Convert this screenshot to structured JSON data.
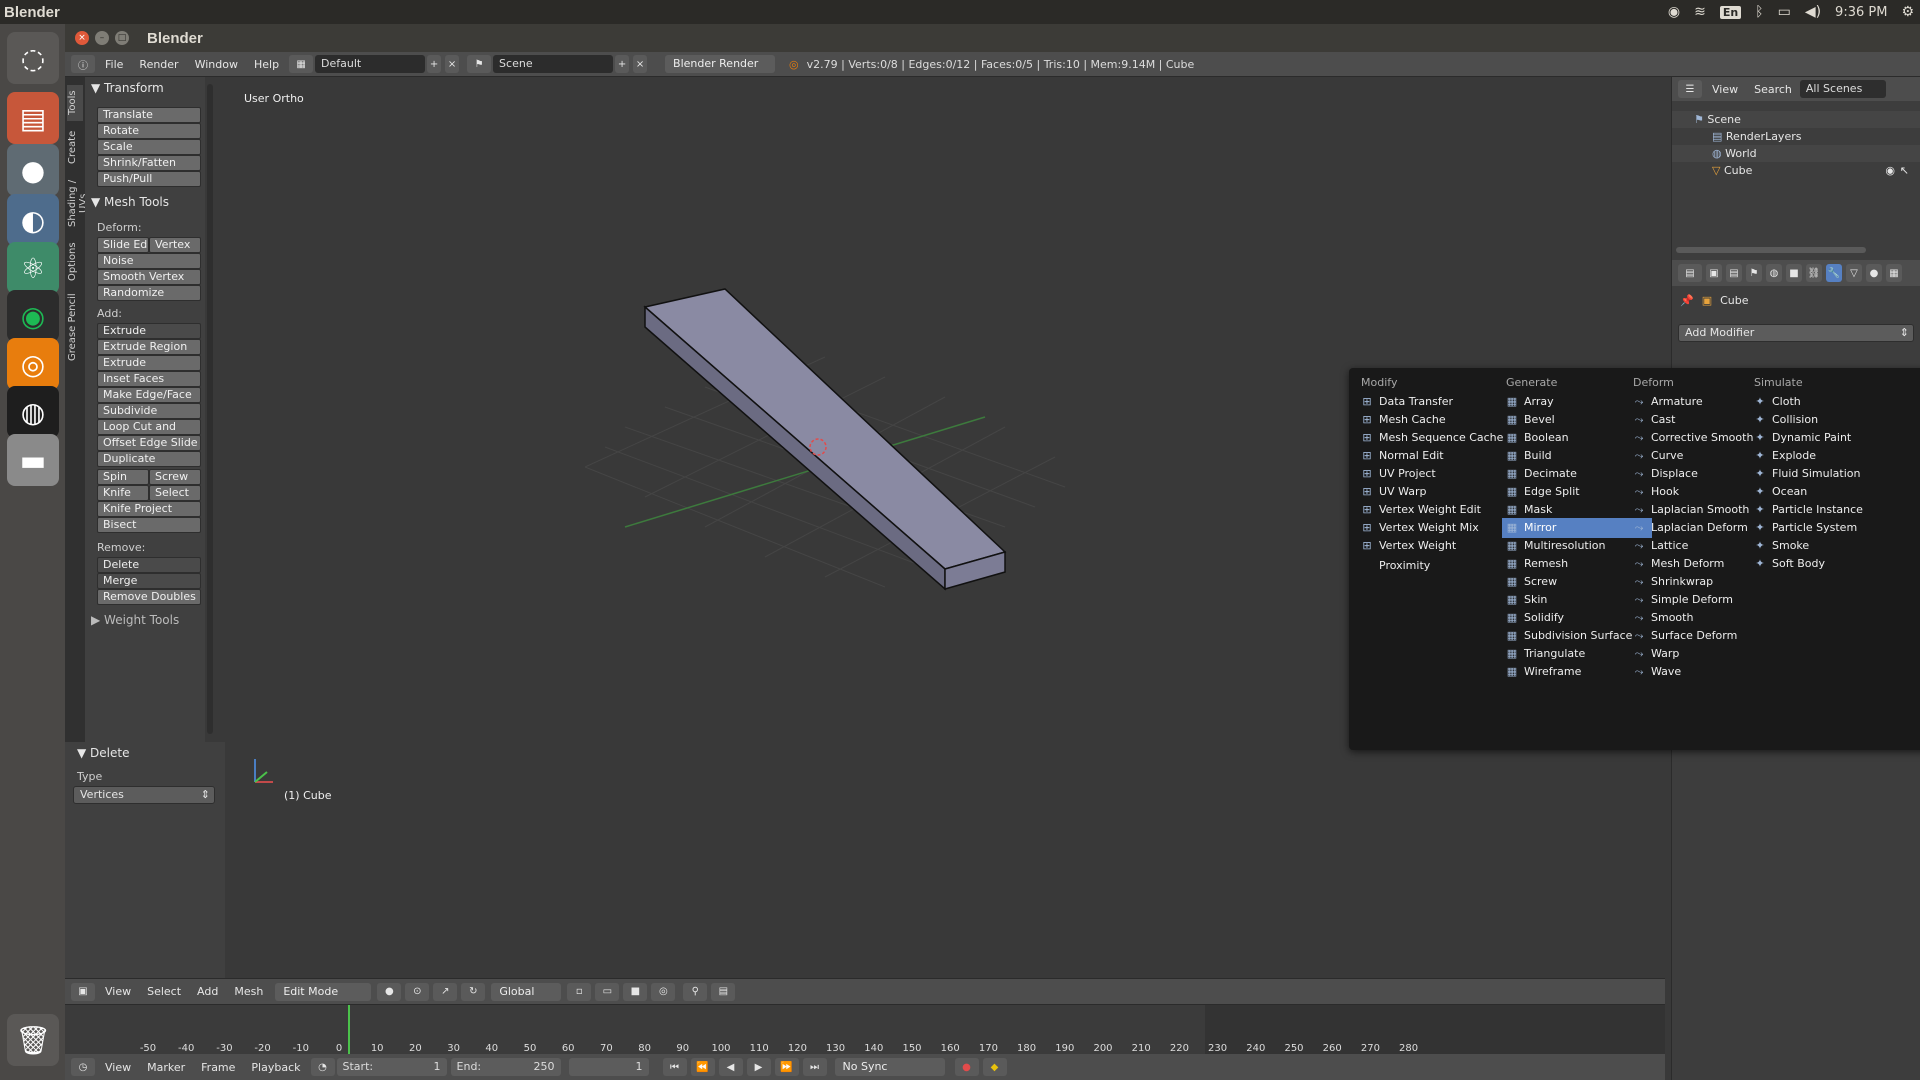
{
  "os": {
    "app_title": "Blender",
    "keyboard_layout": "En",
    "clock": "9:36 PM"
  },
  "window": {
    "title": "Blender"
  },
  "infobar": {
    "menus": [
      "File",
      "Render",
      "Window",
      "Help"
    ],
    "screen_layout": "Default",
    "scene": "Scene",
    "render_engine": "Blender Render",
    "stats": "v2.79 | Verts:0/8 | Edges:0/12 | Faces:0/5 | Tris:10 | Mem:9.14M | Cube"
  },
  "toolshelf": {
    "tabs": [
      "Tools",
      "Create",
      "Shading / UVs",
      "Options",
      "Grease Pencil"
    ],
    "transform_header": "Transform",
    "transform_buttons": [
      "Translate",
      "Rotate",
      "Scale",
      "Shrink/Fatten",
      "Push/Pull"
    ],
    "mesh_tools_header": "Mesh Tools",
    "deform_label": "Deform:",
    "slide_edge": "Slide Ed",
    "vertex": "Vertex",
    "deform_buttons": [
      "Noise",
      "Smooth Vertex",
      "Randomize"
    ],
    "add_label": "Add:",
    "extrude": "Extrude",
    "add_buttons": [
      "Extrude Region",
      "Extrude Individual",
      "Inset Faces",
      "Make Edge/Face",
      "Subdivide",
      "Loop Cut and Slide",
      "Offset Edge Slide",
      "Duplicate"
    ],
    "spin": "Spin",
    "screw": "Screw",
    "knife": "Knife",
    "select": "Select",
    "knife_project": "Knife Project",
    "bisect": "Bisect",
    "remove_label": "Remove:",
    "delete": "Delete",
    "merge": "Merge",
    "remove_doubles": "Remove Doubles",
    "weight_tools": "Weight Tools"
  },
  "operator_panel": {
    "header": "Delete",
    "type_label": "Type",
    "type_value": "Vertices"
  },
  "viewport": {
    "view_label": "User Ortho",
    "object_label": "(1) Cube"
  },
  "view3d_header": {
    "menus": [
      "View",
      "Select",
      "Add",
      "Mesh"
    ],
    "mode": "Edit Mode",
    "orientation": "Global"
  },
  "timeline": {
    "ticks": [
      "-50",
      "-40",
      "-30",
      "-20",
      "-10",
      "0",
      "10",
      "20",
      "30",
      "40",
      "50",
      "60",
      "70",
      "80",
      "90",
      "100",
      "110",
      "120",
      "130",
      "140",
      "150",
      "160",
      "170",
      "180",
      "190",
      "200",
      "210",
      "220",
      "230",
      "240",
      "250",
      "260",
      "270",
      "280"
    ],
    "menus": [
      "View",
      "Marker",
      "Frame",
      "Playback"
    ],
    "start_label": "Start:",
    "start_value": "1",
    "end_label": "End:",
    "end_value": "250",
    "current_frame": "1",
    "sync": "No Sync"
  },
  "outliner": {
    "menus": [
      "View",
      "Search"
    ],
    "filter": "All Scenes",
    "items": [
      "Scene",
      "RenderLayers",
      "World",
      "Cube"
    ]
  },
  "properties": {
    "context_object": "Cube",
    "add_modifier": "Add Modifier"
  },
  "modifier_menu": {
    "columns": [
      {
        "header": "Modify",
        "items": [
          "Data Transfer",
          "Mesh Cache",
          "Mesh Sequence Cache",
          "Normal Edit",
          "UV Project",
          "UV Warp",
          "Vertex Weight Edit",
          "Vertex Weight Mix",
          "Vertex Weight Proximity"
        ]
      },
      {
        "header": "Generate",
        "items": [
          "Array",
          "Bevel",
          "Boolean",
          "Build",
          "Decimate",
          "Edge Split",
          "Mask",
          "Mirror",
          "Multiresolution",
          "Remesh",
          "Screw",
          "Skin",
          "Solidify",
          "Subdivision Surface",
          "Triangulate",
          "Wireframe"
        ]
      },
      {
        "header": "Deform",
        "items": [
          "Armature",
          "Cast",
          "Corrective Smooth",
          "Curve",
          "Displace",
          "Hook",
          "Laplacian Smooth",
          "Laplacian Deform",
          "Lattice",
          "Mesh Deform",
          "Shrinkwrap",
          "Simple Deform",
          "Smooth",
          "Surface Deform",
          "Warp",
          "Wave"
        ]
      },
      {
        "header": "Simulate",
        "items": [
          "Cloth",
          "Collision",
          "Dynamic Paint",
          "Explode",
          "Fluid Simulation",
          "Ocean",
          "Particle Instance",
          "Particle System",
          "Smoke",
          "Soft Body"
        ]
      }
    ],
    "highlighted": "Mirror"
  },
  "colors": {
    "highlight": "#5680c2",
    "menu_bg": "#191919",
    "ui_bg": "#393939"
  }
}
